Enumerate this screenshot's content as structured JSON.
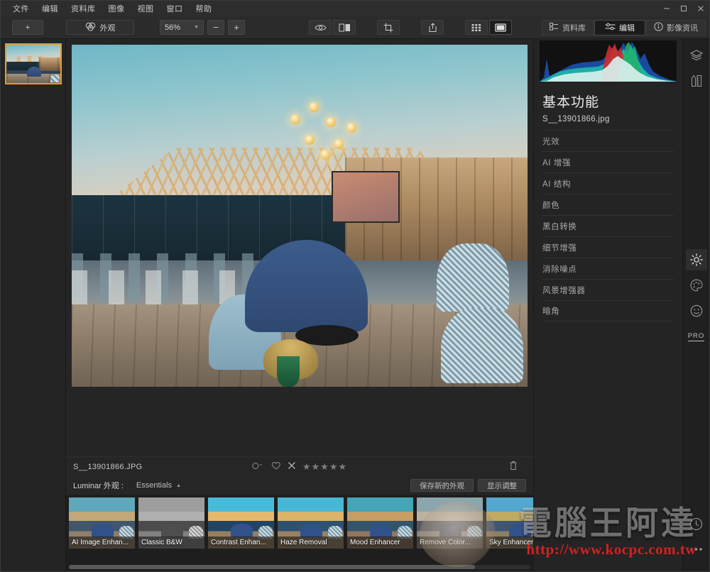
{
  "window": {
    "menu": [
      "文件",
      "编辑",
      "资料库",
      "图像",
      "视图",
      "窗口",
      "帮助"
    ],
    "controls": {
      "minimize": "—",
      "maximize": "▢",
      "close": "✕"
    }
  },
  "toolbar": {
    "add_label": "+",
    "looks_label": "外观",
    "zoom_value": "56%",
    "zoom_out_label": "−",
    "zoom_in_label": "+",
    "icons": {
      "preview": "eye-icon",
      "compare": "before-after-icon",
      "crop": "crop-icon",
      "export": "export-icon",
      "grid_view": "grid-view-icon",
      "single_view": "single-view-icon"
    },
    "tabs": [
      {
        "label": "资料库",
        "icon": "library-icon",
        "active": false
      },
      {
        "label": "编辑",
        "icon": "sliders-icon",
        "active": true
      },
      {
        "label": "影像资讯",
        "icon": "info-icon",
        "active": false
      }
    ]
  },
  "panel": {
    "title": "基本功能",
    "file": "S__13901866.jpg",
    "items": [
      {
        "label": "光效"
      },
      {
        "label": "AI 增强"
      },
      {
        "label": "AI 结构"
      },
      {
        "label": "颜色"
      },
      {
        "label": "黑白转换"
      },
      {
        "label": "细节增强"
      },
      {
        "label": "消除噪点"
      },
      {
        "label": "风景增强器"
      },
      {
        "label": "暗角"
      }
    ]
  },
  "rail": {
    "icons": [
      {
        "name": "layers-icon",
        "active": false
      },
      {
        "name": "tools-icon",
        "active": false
      },
      {
        "name": "essentials-sun-icon",
        "active": true
      },
      {
        "name": "creative-palette-icon",
        "active": false
      },
      {
        "name": "portrait-face-icon",
        "active": false
      },
      {
        "name": "pro-icon",
        "active": false
      }
    ],
    "pro_label": "PRO",
    "history_icon": "history-clock-icon",
    "more_icon": "more-dots-icon"
  },
  "info": {
    "filename": "S__13901866.JPG",
    "color_label_icon": "color-label-icon",
    "favorite_icon": "heart-icon",
    "reject_icon": "reject-x-icon",
    "stars": "★★★★★",
    "star_count": 5,
    "delete_icon": "trash-icon"
  },
  "looks": {
    "label": "Luminar 外观 :",
    "collection": "Essentials",
    "save_button": "保存新的外观",
    "adjust_button": "显示调整"
  },
  "presets": [
    {
      "label": "AI Image Enhan...",
      "style": "ai"
    },
    {
      "label": "Classic B&W",
      "style": "bw"
    },
    {
      "label": "Contrast Enhan...",
      "style": "contrast"
    },
    {
      "label": "Haze Removal",
      "style": "haze"
    },
    {
      "label": "Mood Enhancer",
      "style": "mood"
    },
    {
      "label": "Remove Color...",
      "style": "remove"
    },
    {
      "label": "Sky Enhancer",
      "style": "sky"
    }
  ],
  "watermark": {
    "brand": "電腦王阿達",
    "url": "http://www.kocpc.com.tw"
  },
  "colors": {
    "accent": "#e59c2b",
    "panel_bg": "#242424",
    "toolbar_bg": "#2b2b2b",
    "watermark_red": "#e02323"
  }
}
